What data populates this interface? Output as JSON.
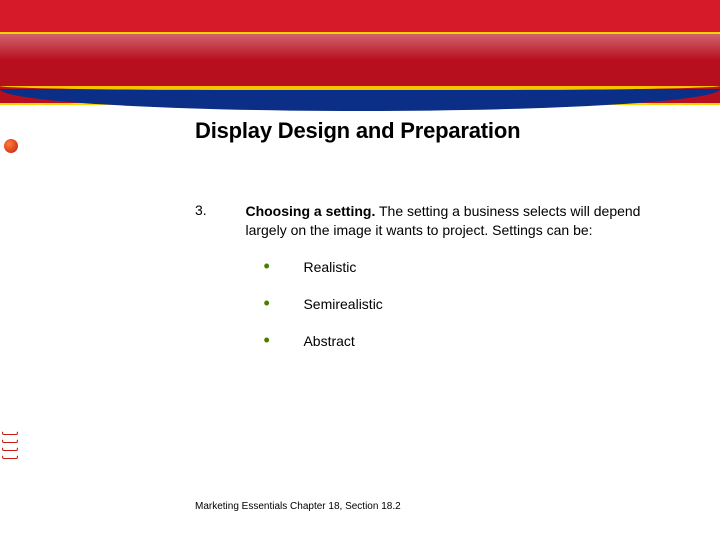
{
  "title": "Display Design and Preparation",
  "item": {
    "number": "3.",
    "lead": "Choosing a setting.",
    "text": " The setting a business selects will depend largely on the image it wants to project. Settings can be:",
    "bullets": [
      "Realistic",
      "Semirealistic",
      "Abstract"
    ]
  },
  "footer": "Marketing Essentials Chapter 18, Section 18.2"
}
